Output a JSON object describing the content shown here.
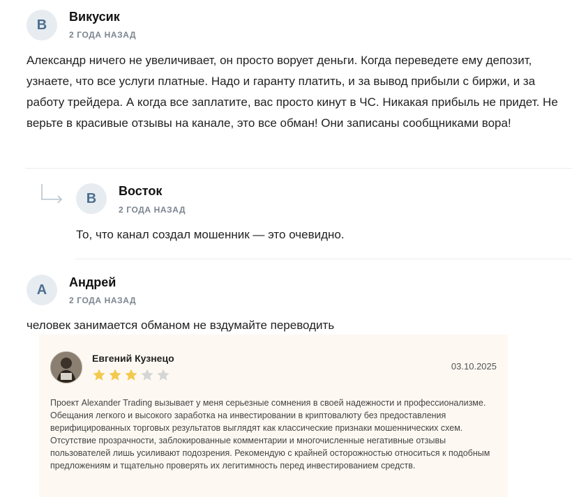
{
  "comments": [
    {
      "initial": "В",
      "author": "Викусик",
      "date": "2 года назад",
      "text": "Александр ничего не увеличивает, он просто ворует деньги. Когда переведете ему депозит, узнаете, что все услуги платные. Надо и гаранту платить, и за вывод прибыли с биржи, и за работу трейдера. А когда все заплатите, вас просто кинут в ЧС. Никакая прибыль не придет. Не верьте в красивые отзывы на канале, это все обман! Они записаны сообщниками вора!"
    },
    {
      "initial": "В",
      "author": "Восток",
      "date": "2 года назад",
      "text": "То, что канал создал мошенник — это очевидно."
    },
    {
      "initial": "А",
      "author": "Андрей",
      "date": "2 года назад",
      "text": "человек занимается обманом не вздумайте переводить"
    }
  ],
  "review": {
    "name": "Евгений Кузнецо",
    "date": "03.10.2025",
    "rating": 3,
    "max_rating": 5,
    "text": "Проект Alexander Trading вызывает у меня серьезные сомнения в своей надежности и профессионализме. Обещания легкого и высокого заработка на инвестировании в криптовалюту без предоставления верифицированных торговых результатов выглядят как классические признаки мошеннических схем. Отсутствие прозрачности, заблокированные комментарии и многочисленные негативные отзывы пользователей лишь усиливают подозрения. Рекомендую с крайней осторожностью относиться к подобным предложениям и тщательно проверять их легитимность перед инвестированием средств."
  },
  "colors": {
    "avatar_bg": "#e7ecf1",
    "avatar_text": "#4d6f8e",
    "review_bg": "#fdf8f2",
    "star_filled": "#f2c94c",
    "star_empty": "#d5d5d5"
  }
}
